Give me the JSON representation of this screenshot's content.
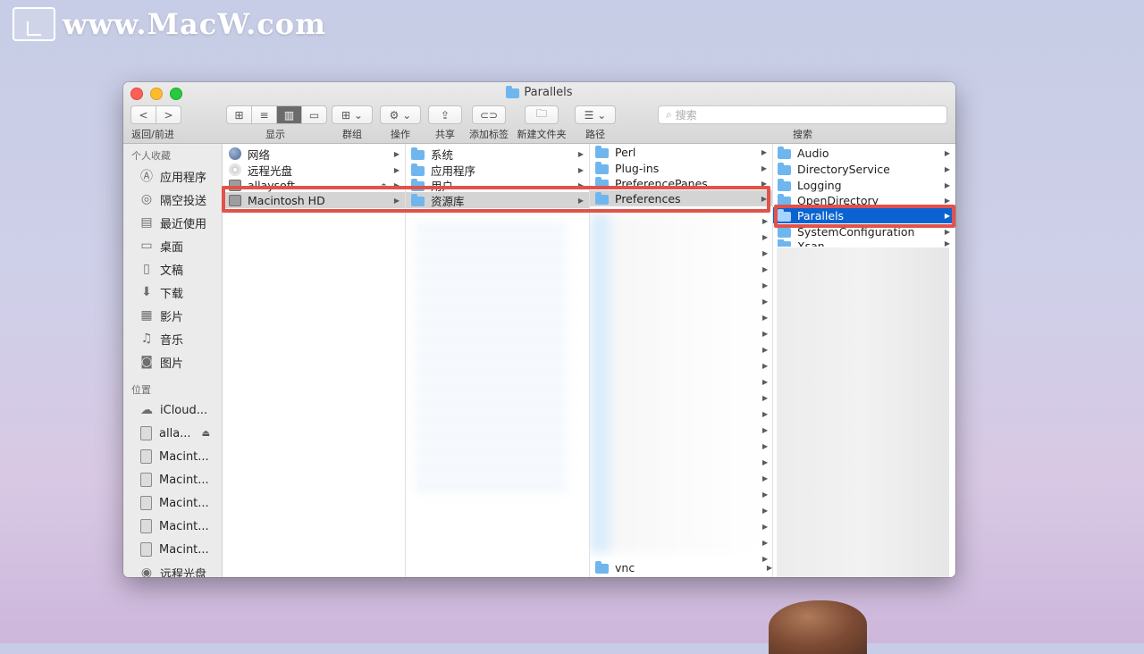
{
  "watermark": {
    "text": "www.MacW.com"
  },
  "window": {
    "title": "Parallels"
  },
  "toolbar": {
    "nav_back": "<",
    "nav_forward": ">",
    "labels": {
      "nav": "返回/前进",
      "view": "显示",
      "group": "群组",
      "action": "操作",
      "share": "共享",
      "tags": "添加标签",
      "new_folder": "新建文件夹",
      "path": "路径",
      "search": "搜索"
    },
    "search_placeholder": "搜索"
  },
  "sidebar": {
    "favorites_header": "个人收藏",
    "favorites": [
      {
        "label": "应用程序",
        "icon": "applications-icon"
      },
      {
        "label": "隔空投送",
        "icon": "airdrop-icon"
      },
      {
        "label": "最近使用",
        "icon": "recents-icon"
      },
      {
        "label": "桌面",
        "icon": "desktop-icon"
      },
      {
        "label": "文稿",
        "icon": "documents-icon"
      },
      {
        "label": "下载",
        "icon": "downloads-icon"
      },
      {
        "label": "影片",
        "icon": "movies-icon"
      },
      {
        "label": "音乐",
        "icon": "music-icon"
      },
      {
        "label": "图片",
        "icon": "pictures-icon"
      }
    ],
    "locations_header": "位置",
    "locations": [
      {
        "label": "iCloud...",
        "icon": "cloud-icon"
      },
      {
        "label": "alla...",
        "icon": "disk-icon"
      },
      {
        "label": "Macint...",
        "icon": "disk-icon"
      },
      {
        "label": "Macint...",
        "icon": "disk-icon"
      },
      {
        "label": "Macint...",
        "icon": "disk-icon"
      },
      {
        "label": "Macint...",
        "icon": "disk-icon"
      },
      {
        "label": "Macint...",
        "icon": "disk-icon"
      },
      {
        "label": "远程光盘",
        "icon": "remote-disc-icon"
      }
    ]
  },
  "columns": {
    "col1": [
      "网络",
      "远程光盘",
      "allaysoft",
      "Macintosh HD"
    ],
    "col2": [
      "系统",
      "应用程序",
      "用户",
      "资源库"
    ],
    "col3": [
      "Perl",
      "Plug-ins",
      "PreferencePanes",
      "Preferences",
      "vnc"
    ],
    "col4": [
      "Audio",
      "DirectoryService",
      "Logging",
      "OpenDirectory",
      "Parallels",
      "SystemConfiguration",
      "Xsan"
    ]
  },
  "colors": {
    "selection_blue": "#0a63d1",
    "highlight_red": "#e2524a"
  }
}
